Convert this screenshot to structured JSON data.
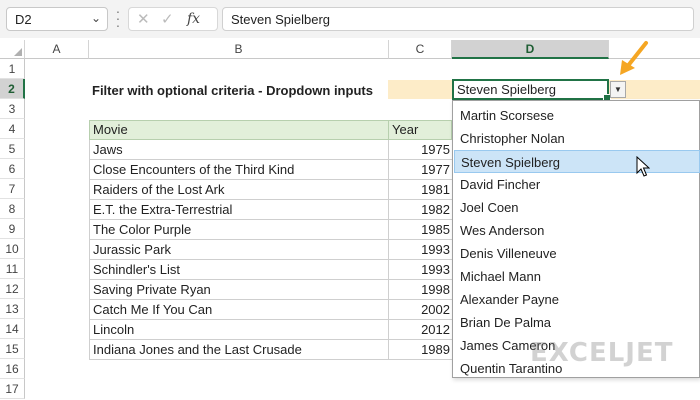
{
  "formula_bar": {
    "name_box": "D2",
    "formula": "Steven Spielberg"
  },
  "columns": [
    "A",
    "B",
    "C",
    "D"
  ],
  "selected_column": "D",
  "rows": [
    "1",
    "2",
    "3",
    "4",
    "5",
    "6",
    "7",
    "8",
    "9",
    "10",
    "11",
    "12",
    "13",
    "14",
    "15",
    "16",
    "17"
  ],
  "selected_row": "2",
  "sheet": {
    "title": "Filter with optional criteria - Dropdown inputs",
    "input_value": "Steven Spielberg",
    "table": {
      "headers": [
        "Movie",
        "Year"
      ],
      "rows": [
        {
          "movie": "Jaws",
          "year": "1975"
        },
        {
          "movie": "Close Encounters of the Third Kind",
          "year": "1977"
        },
        {
          "movie": "Raiders of the Lost Ark",
          "year": "1981"
        },
        {
          "movie": "E.T. the Extra-Terrestrial",
          "year": "1982"
        },
        {
          "movie": "The Color Purple",
          "year": "1985"
        },
        {
          "movie": "Jurassic Park",
          "year": "1993"
        },
        {
          "movie": "Schindler's List",
          "year": "1993"
        },
        {
          "movie": "Saving Private Ryan",
          "year": "1998"
        },
        {
          "movie": "Catch Me If You Can",
          "year": "2002"
        },
        {
          "movie": "Lincoln",
          "year": "2012"
        },
        {
          "movie": "Indiana Jones and the Last Crusade",
          "year": "1989"
        }
      ]
    }
  },
  "dropdown": {
    "items": [
      "Martin Scorsese",
      "Christopher Nolan",
      "Steven Spielberg",
      "David Fincher",
      "Joel Coen",
      "Wes Anderson",
      "Denis Villeneuve",
      "Michael Mann",
      "Alexander Payne",
      "Brian De Palma",
      "James Cameron",
      "Quentin Tarantino"
    ],
    "highlighted": "Steven Spielberg"
  },
  "colors": {
    "accent": "#217346",
    "criteria_fill": "#fdecc8",
    "header_fill": "#e2efda",
    "highlight": "#cce4f7",
    "annotation_arrow": "#f5a623"
  },
  "watermark": "EXCELJET"
}
